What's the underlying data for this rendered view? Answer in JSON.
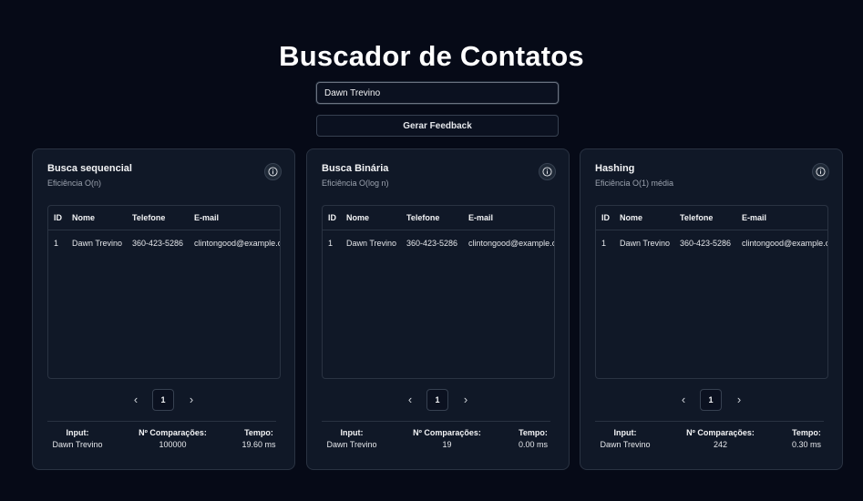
{
  "title": "Buscador de Contatos",
  "search": {
    "value": "Dawn Trevino",
    "placeholder": ""
  },
  "feedback_button": "Gerar Feedback",
  "table_headers": {
    "id": "ID",
    "nome": "Nome",
    "telefone": "Telefone",
    "email": "E-mail"
  },
  "stat_labels": {
    "input": "Input:",
    "comparisons": "Nº Comparações:",
    "time": "Tempo:"
  },
  "cards": [
    {
      "title": "Busca sequencial",
      "subtitle": "Eficiência O(n)",
      "row": {
        "id": "1",
        "nome": "Dawn Trevino",
        "telefone": "360-423-5286",
        "email": "clintongood@example.org"
      },
      "page": "1",
      "stats": {
        "input": "Dawn Trevino",
        "comparisons": "100000",
        "time": "19.60 ms"
      }
    },
    {
      "title": "Busca Binária",
      "subtitle": "Eficiência O(log n)",
      "row": {
        "id": "1",
        "nome": "Dawn Trevino",
        "telefone": "360-423-5286",
        "email": "clintongood@example.org"
      },
      "page": "1",
      "stats": {
        "input": "Dawn Trevino",
        "comparisons": "19",
        "time": "0.00 ms"
      }
    },
    {
      "title": "Hashing",
      "subtitle": "Eficiência O(1) média",
      "row": {
        "id": "1",
        "nome": "Dawn Trevino",
        "telefone": "360-423-5286",
        "email": "clintongood@example.org"
      },
      "page": "1",
      "stats": {
        "input": "Dawn Trevino",
        "comparisons": "242",
        "time": "0.30 ms"
      }
    }
  ],
  "icons": {
    "info": "info-circle-icon",
    "prev": "chevron-left-icon",
    "next": "chevron-right-icon"
  }
}
